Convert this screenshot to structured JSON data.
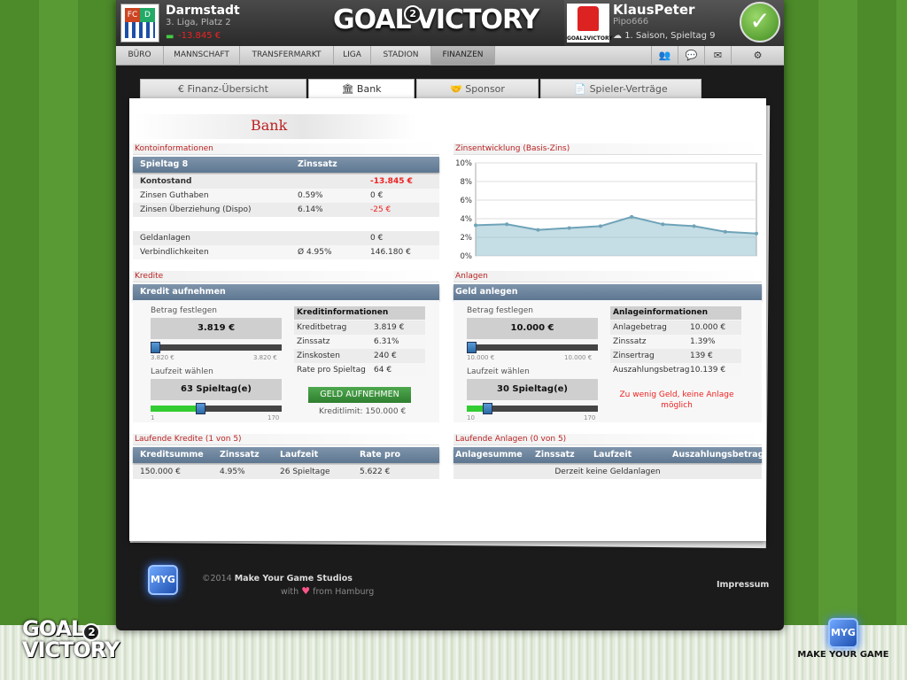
{
  "header": {
    "club_crest_a": "FC",
    "club_crest_b": "D",
    "club_name": "Darmstadt",
    "league": "3. Liga, Platz 2",
    "money": "-13.845 €",
    "logo_left": "GOAL",
    "logo_two": "2",
    "logo_right": "VICTORY",
    "user_name": "KlausPeter",
    "user_nick": "Pipo666",
    "user_badge_text": "GOAL2VICTORY",
    "season": "1. Saison, Spieltag 9",
    "confirm_icon": "check-icon"
  },
  "nav": {
    "items": [
      "BÜRO",
      "MANNSCHAFT",
      "TRANSFERMARKT",
      "LIGA",
      "STADION",
      "FINANZEN"
    ],
    "active": "FINANZEN",
    "icons": [
      "friends-icon",
      "chat-icon",
      "mail-icon",
      "settings-icon"
    ]
  },
  "tabs": [
    {
      "label": "€ Finanz-Übersicht",
      "active": false
    },
    {
      "label": "🏛 Bank",
      "active": true
    },
    {
      "label": "🤝 Sponsor",
      "active": false
    },
    {
      "label": "📄 Spieler-Verträge",
      "active": false
    }
  ],
  "page_title": "Bank",
  "konto": {
    "section": "Kontoinformationen",
    "col1": "Spieltag 8",
    "col2": "Zinssatz",
    "rows": [
      {
        "label": "Kontostand",
        "rate": "",
        "value": "-13.845 €"
      },
      {
        "label": "Zinsen Guthaben",
        "rate": "0.59%",
        "value": "0 €"
      },
      {
        "label": "Zinsen Überziehung (Dispo)",
        "rate": "6.14%",
        "value": "-25 €"
      },
      {
        "label": "Geldanlagen",
        "rate": "",
        "value": "0 €"
      },
      {
        "label": "Verbindlichkeiten",
        "rate": "Ø 4.95%",
        "value": "146.180 €"
      }
    ]
  },
  "chart_section": "Zinsentwicklung (Basis-Zins)",
  "chart_data": {
    "type": "area",
    "x": [
      1,
      2,
      3,
      4,
      5,
      6,
      7,
      8,
      9,
      10
    ],
    "values": [
      3.3,
      3.4,
      2.8,
      3.0,
      3.2,
      4.2,
      3.4,
      3.2,
      2.6,
      2.4
    ],
    "ylim": [
      0,
      10
    ],
    "yticks": [
      "10%",
      "8%",
      "6%",
      "4%",
      "2%",
      "0%"
    ],
    "grid": true,
    "color": "#7fb3c6"
  },
  "kredite": {
    "section": "Kredite",
    "header": "Kredit aufnehmen",
    "amount_label": "Betrag festlegen",
    "amount": "3.819 €",
    "amount_min": "3.820 €",
    "amount_max": "3.820 €",
    "amount_fraction": 0.0,
    "duration_label": "Laufzeit wählen",
    "duration": "63 Spieltag(e)",
    "duration_min": "1",
    "duration_max": "170",
    "duration_fraction": 0.37,
    "info_header": "Kreditinformationen",
    "info": [
      {
        "label": "Kreditbetrag",
        "value": "3.819 €"
      },
      {
        "label": "Zinssatz",
        "value": "6.31%"
      },
      {
        "label": "Zinskosten",
        "value": "240 €"
      },
      {
        "label": "Rate pro Spieltag",
        "value": "64 €"
      }
    ],
    "button": "GELD AUFNEHMEN",
    "limit": "Kreditlimit: 150.000 €"
  },
  "anlagen": {
    "section": "Anlagen",
    "header": "Geld anlegen",
    "amount_label": "Betrag festlegen",
    "amount": "10.000 €",
    "amount_min": "10.000 €",
    "amount_max": "10.000 €",
    "amount_fraction": 0.0,
    "duration_label": "Laufzeit wählen",
    "duration": "30 Spieltag(e)",
    "duration_min": "10",
    "duration_max": "170",
    "duration_fraction": 0.13,
    "info_header": "Anlageinformationen",
    "info": [
      {
        "label": "Anlagebetrag",
        "value": "10.000 €"
      },
      {
        "label": "Zinssatz",
        "value": "1.39%"
      },
      {
        "label": "Zinsertrag",
        "value": "139 €"
      },
      {
        "label": "Auszahlungsbetrag",
        "value": "10.139 €"
      }
    ],
    "warning": "Zu wenig Geld, keine Anlage möglich"
  },
  "laufende_kredite": {
    "section": "Laufende Kredite (1 von 5)",
    "columns": [
      "Kreditsumme",
      "Zinssatz",
      "Laufzeit",
      "Rate pro Spieltag"
    ],
    "rows": [
      [
        "150.000 €",
        "4.95%",
        "26 Spieltage",
        "5.622 €"
      ]
    ]
  },
  "laufende_anlagen": {
    "section": "Laufende Anlagen (0 von 5)",
    "columns": [
      "Anlagesumme",
      "Zinssatz",
      "Laufzeit",
      "Auszahlungsbetrag"
    ],
    "empty": "Derzeit keine Geldanlagen"
  },
  "footer": {
    "logo": "MYG",
    "copyright_prefix": "©2014",
    "copyright_company": "Make Your Game Studios",
    "with": "with",
    "heart": "♥",
    "from": "from Hamburg",
    "impressum": "Impressum"
  },
  "corners": {
    "left_logo_top": "GOAL",
    "left_logo_bottom": "VICTORY",
    "left_logo_two": "2",
    "right_logo": "MYG",
    "right_text": "MAKE YOUR GAME"
  }
}
